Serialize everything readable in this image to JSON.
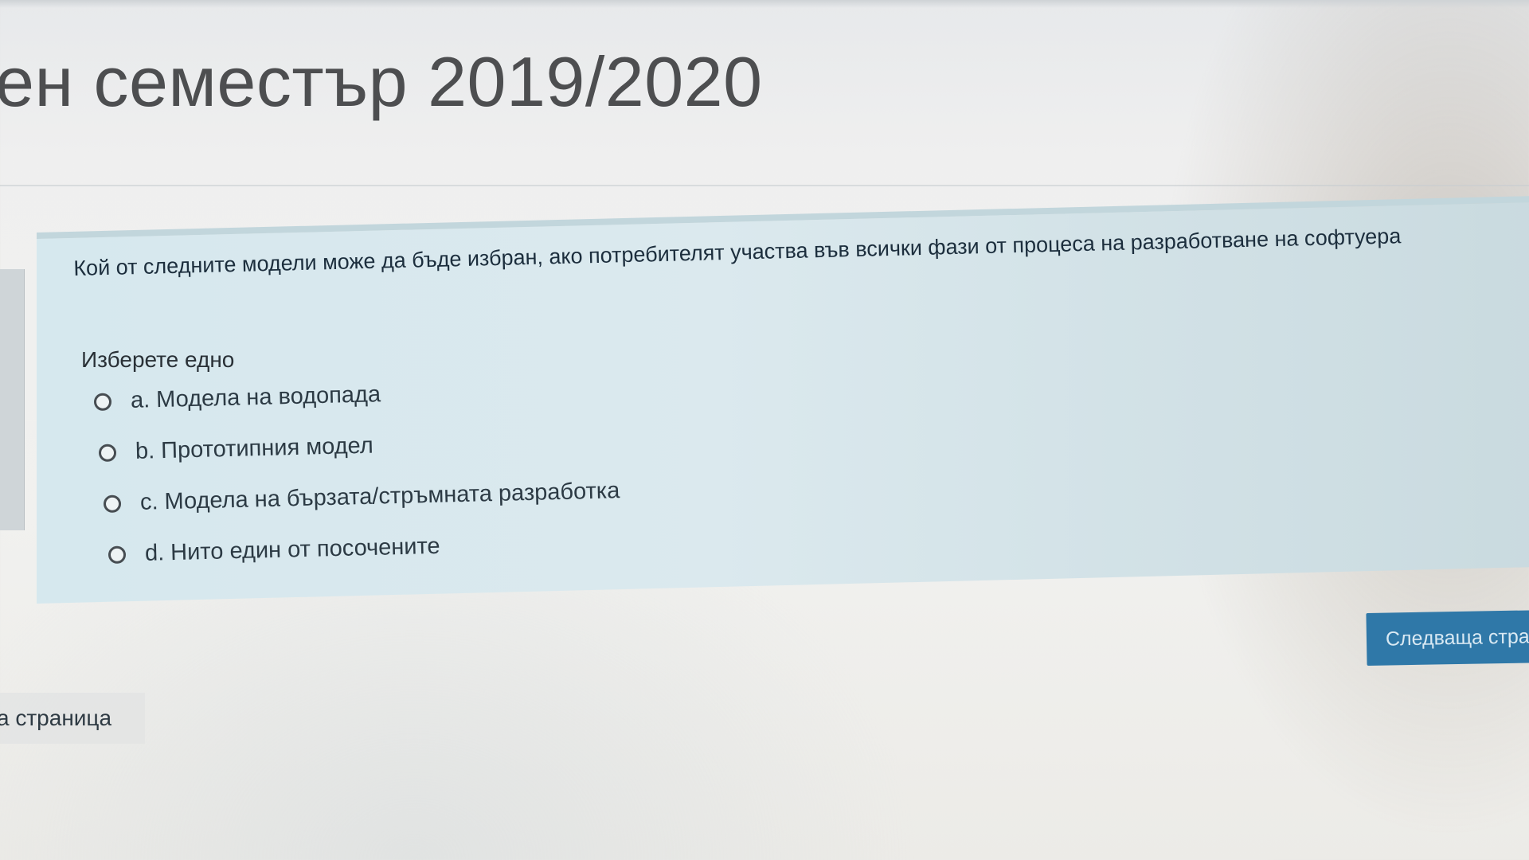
{
  "page": {
    "title": "ен семестър 2019/2020"
  },
  "question": {
    "text": "Кой от следните модели може да бъде избран, ако потребителят участва във всички фази от процеса на разработване на софтуера",
    "prompt": "Изберете едно",
    "options": [
      {
        "label": "a. Модела на водопада",
        "selected": false
      },
      {
        "label": "b. Прототипния модел",
        "selected": false
      },
      {
        "label": "c. Модела на бързата/стръмната разработка",
        "selected": false
      },
      {
        "label": "d. Нито един от посочените",
        "selected": false
      }
    ]
  },
  "navigation": {
    "next_label": "Следваща стра",
    "prev_label": "а страница"
  },
  "colors": {
    "card_background": "#d6e8ee",
    "button": "#2f78a8",
    "title": "#4d4e50"
  }
}
